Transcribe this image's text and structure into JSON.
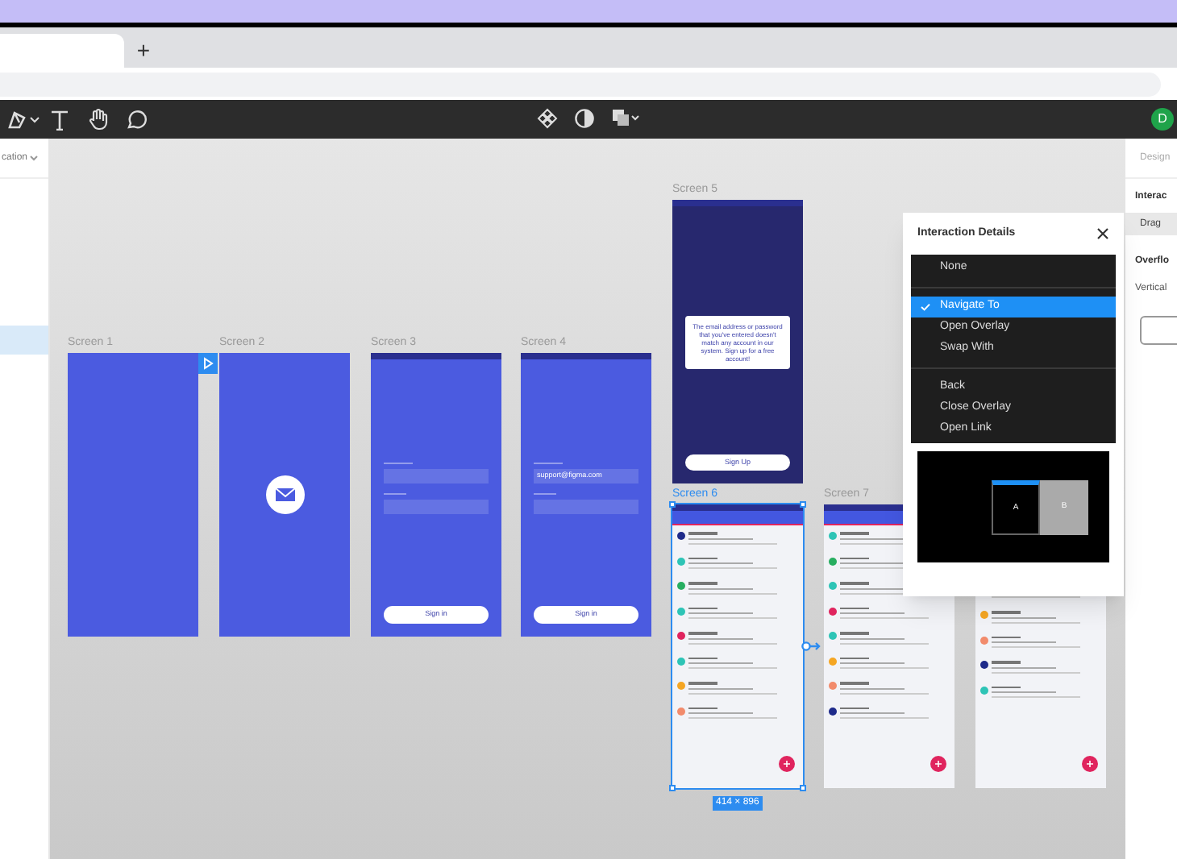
{
  "browser": {
    "new_tab_label": "+"
  },
  "toolbar": {
    "avatar_letter": "D"
  },
  "left_panel": {
    "tab_label": "cation"
  },
  "frames": [
    {
      "title": "Screen 1",
      "kind": "blank",
      "selected": false
    },
    {
      "title": "Screen 2",
      "kind": "envelope",
      "selected": false
    },
    {
      "title": "Screen 3",
      "kind": "login",
      "selected": false,
      "button": "Sign in"
    },
    {
      "title": "Screen 4",
      "kind": "login",
      "selected": false,
      "email": "support@figma.com",
      "button": "Sign in"
    },
    {
      "title": "Screen 5",
      "kind": "alert",
      "selected": false,
      "message": "The email address or password that you've entered doesn't match any account in our system. Sign up for a free account!",
      "button": "Sign Up"
    },
    {
      "title": "Screen 6",
      "kind": "inbox",
      "selected": true,
      "size_label": "414 × 896"
    },
    {
      "title": "Screen 7",
      "kind": "inbox",
      "selected": false
    },
    {
      "kind": "inbox",
      "selected": false
    }
  ],
  "interaction_details": {
    "title": "Interaction Details",
    "sections": [
      [
        {
          "label": "None",
          "selected": false
        }
      ],
      [
        {
          "label": "Navigate To",
          "selected": true
        },
        {
          "label": "Open Overlay",
          "selected": false
        },
        {
          "label": "Swap With",
          "selected": false
        }
      ],
      [
        {
          "label": "Back",
          "selected": false
        },
        {
          "label": "Close Overlay",
          "selected": false
        },
        {
          "label": "Open Link",
          "selected": false
        }
      ]
    ],
    "preview": {
      "a": "A",
      "b": "B"
    }
  },
  "right_panel": {
    "tab": "Design",
    "section": "Interac",
    "trigger": "Drag",
    "overflow_heading": "Overflo",
    "overflow_value": "Vertical"
  }
}
